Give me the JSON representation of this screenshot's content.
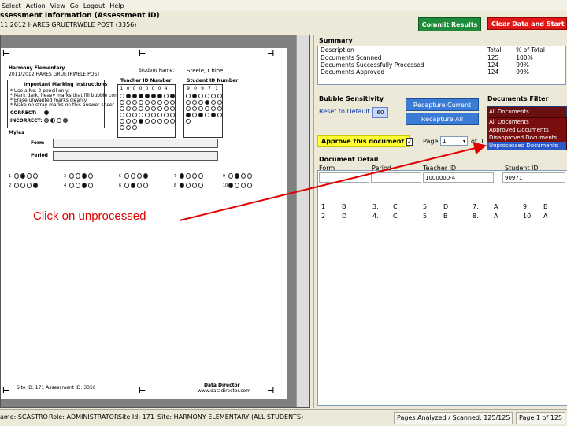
{
  "menu": [
    "Select",
    "Action",
    "View",
    "Go",
    "Logout",
    "Help"
  ],
  "header": {
    "title": "ssessment Information (Assessment ID)",
    "subtitle": "11 2012 HARES GRUETRWELE POST (3356)"
  },
  "buttons": {
    "commit": "Commit Results",
    "clear": "Clear Data and Start O"
  },
  "summary": {
    "label": "Summary",
    "columns": [
      "Description",
      "Total",
      "% of Total"
    ],
    "rows": [
      [
        "Documents Scanned",
        "125",
        "100%"
      ],
      [
        "Documents Successfully Processed",
        "124",
        "99%"
      ],
      [
        "Documents Approved",
        "124",
        "99%"
      ]
    ]
  },
  "sensitivity": {
    "label": "Bubble Sensitivity",
    "reset_label": "Reset to Default",
    "value": "60",
    "recapture_current": "Recapture Current",
    "recapture_all": "Recapture All"
  },
  "filter": {
    "label": "Documents Filter",
    "selected": "All Documents",
    "options": [
      "All Documents",
      "Approved Documents",
      "Disapproved Documents",
      "Unprocessed Documents"
    ],
    "highlighted_index": 3
  },
  "approve": {
    "label": "Approve this document",
    "checked": "✓"
  },
  "pager": {
    "label": "Page",
    "value": "1",
    "of_label": "of",
    "total": "1"
  },
  "detail": {
    "label": "Document Detail",
    "columns": [
      "Form",
      "Period",
      "Teacher ID",
      "Student ID"
    ],
    "values": [
      "",
      "",
      "1000000-4",
      "90971"
    ],
    "answers": [
      [
        "1",
        "B",
        "3.",
        "C",
        "5",
        "D",
        "7.",
        "A",
        "9.",
        "B"
      ],
      [
        "2",
        "D",
        "4.",
        "C",
        "5",
        "B",
        "8.",
        "A",
        "10.",
        "A"
      ]
    ]
  },
  "sheet": {
    "school": "Harmony Elementary",
    "school_sub": "2011/2012 HARES GRUETRWELE POST",
    "student_name_label": "Student Name:",
    "student_name": "Steele, Chloe",
    "instructions_title": "Important Marking Instructions",
    "instructions": [
      "* Use a No. 2 pencil only.",
      "* Mark dark, heavy marks that fill bubble completely.",
      "* Erase unwanted marks cleanly.",
      "* Make no stray marks on this answer sheet."
    ],
    "correct_label": "CORRECT:",
    "incorrect_label": "INCORRECT:",
    "teacher_id_label": "Teacher ID Number",
    "teacher_digits": [
      "1",
      "0",
      "0",
      "0",
      "0",
      "0",
      "0",
      "4"
    ],
    "student_id_label": "Student ID Number",
    "student_digits": [
      "9",
      "0",
      "9",
      "7",
      "1"
    ],
    "myles_label": "Myles",
    "form_label": "Form",
    "period_label": "Period",
    "footer_left": "Site ID: 171    Assessment ID: 3356",
    "footer_right_1": "Data Director",
    "footer_right_2": "www.datadirector.com"
  },
  "annotation": {
    "text": "Click on unprocessed",
    "color": "#e00000"
  },
  "status": {
    "user": "ame: SCASTRO",
    "role": "Role: ADMINISTRATOR",
    "site_id": "Site Id: 171",
    "site": "Site: HARMONY ELEMENTARY (ALL STUDENTS)",
    "pages": "Pages Analyzed / Scanned: 125/125",
    "page_of": "Page 1 of 125"
  }
}
